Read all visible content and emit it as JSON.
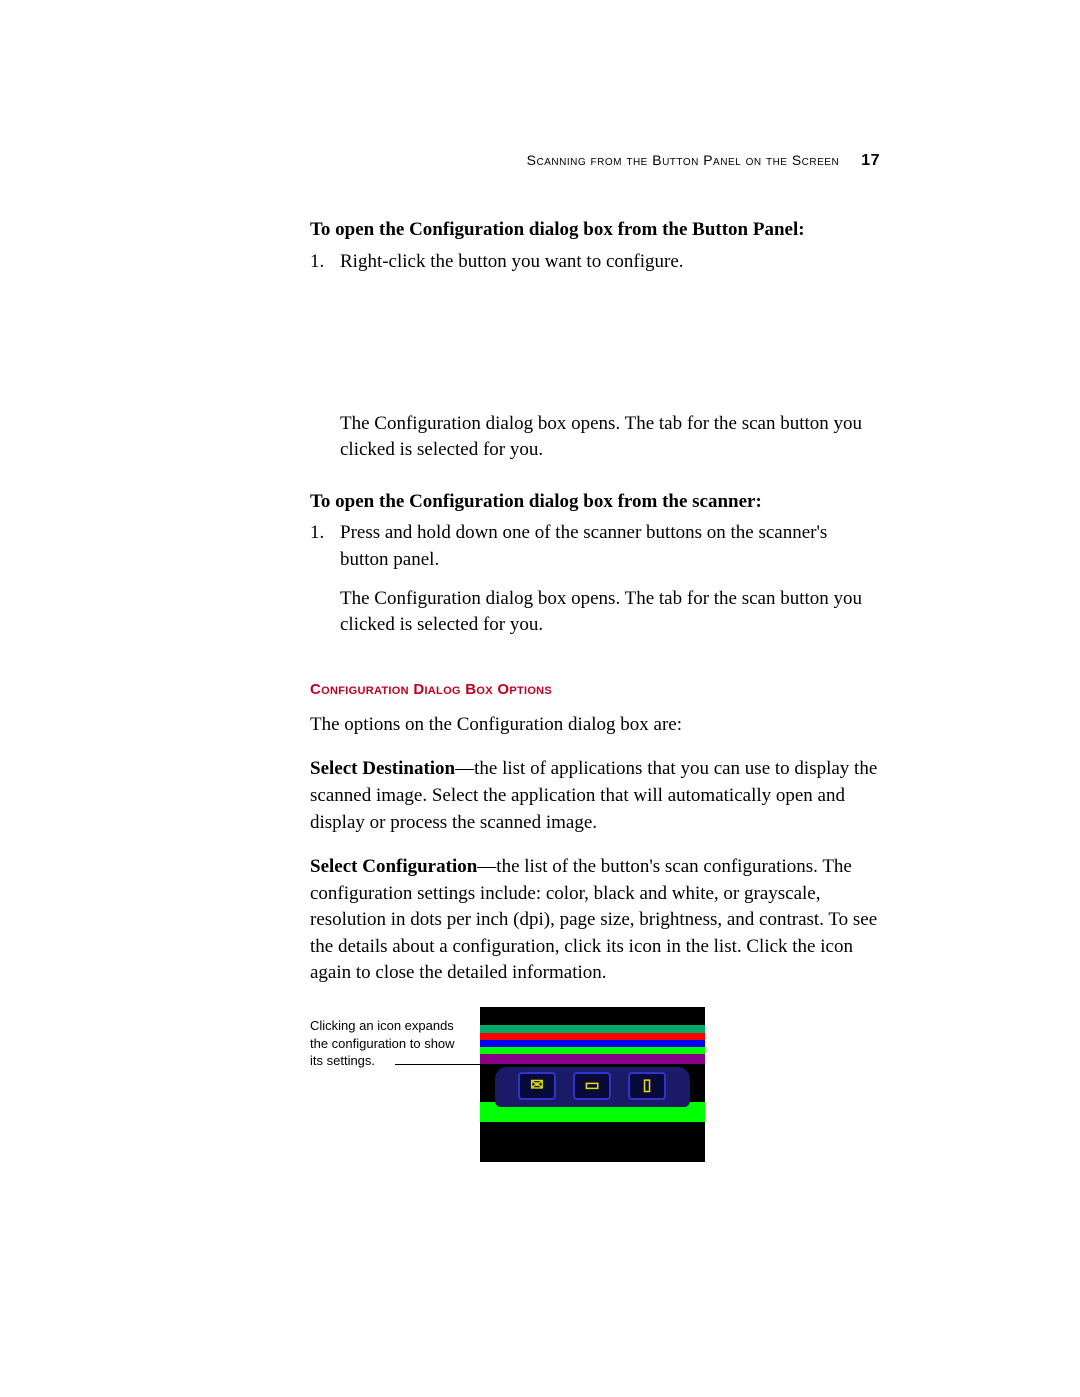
{
  "header": {
    "running_head": "Scanning from the Button Panel on the Screen",
    "page_number": "17"
  },
  "section1": {
    "heading": "To open the Configuration dialog box from the Button Panel:",
    "item1_num": "1.",
    "item1_text": "Right-click the button you want to configure.",
    "after_para": "The Configuration dialog box opens. The tab for the scan button you clicked is selected for you."
  },
  "section2": {
    "heading": "To open the Configuration dialog box from the scanner:",
    "item1_num": "1.",
    "item1_text": "Press and hold down one of the scanner buttons on the scanner's button panel.",
    "after_para": "The Configuration dialog box opens. The tab for the scan button you clicked is selected for you."
  },
  "subsection": {
    "heading": "Configuration Dialog Box Options",
    "intro": "The options on the Configuration dialog box are:",
    "select_dest_label": "Select Destination",
    "select_dest_text": "—the list of applications that you can use to display the scanned image. Select the application that will automatically open and display or process the scanned image.",
    "select_config_label": "Select Configuration",
    "select_config_text": "—the list of the button's scan configurations. The configuration settings include: color, black and white, or grayscale, resolution in dots per inch (dpi), page size, brightness, and contrast. To see the details about a configuration, click its icon in the list. Click the icon again to close the detailed information."
  },
  "figure": {
    "caption": "Clicking an icon expands the configuration to show its settings."
  }
}
